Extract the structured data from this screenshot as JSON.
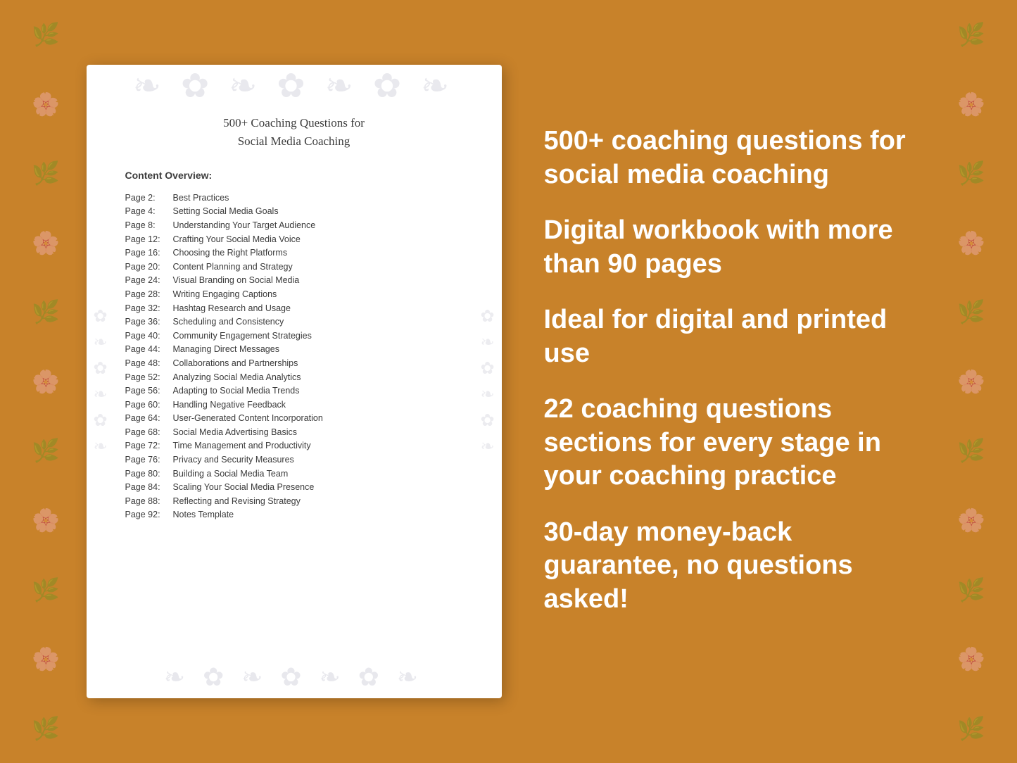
{
  "background": {
    "color": "#C8822A"
  },
  "document": {
    "title_line1": "500+ Coaching Questions for",
    "title_line2": "Social Media Coaching",
    "section_label": "Content Overview:",
    "toc": [
      {
        "page": "Page  2:",
        "title": "Best Practices"
      },
      {
        "page": "Page  4:",
        "title": "Setting Social Media Goals"
      },
      {
        "page": "Page  8:",
        "title": "Understanding Your Target Audience"
      },
      {
        "page": "Page 12:",
        "title": "Crafting Your Social Media Voice"
      },
      {
        "page": "Page 16:",
        "title": "Choosing the Right Platforms"
      },
      {
        "page": "Page 20:",
        "title": "Content Planning and Strategy"
      },
      {
        "page": "Page 24:",
        "title": "Visual Branding on Social Media"
      },
      {
        "page": "Page 28:",
        "title": "Writing Engaging Captions"
      },
      {
        "page": "Page 32:",
        "title": "Hashtag Research and Usage"
      },
      {
        "page": "Page 36:",
        "title": "Scheduling and Consistency"
      },
      {
        "page": "Page 40:",
        "title": "Community Engagement Strategies"
      },
      {
        "page": "Page 44:",
        "title": "Managing Direct Messages"
      },
      {
        "page": "Page 48:",
        "title": "Collaborations and Partnerships"
      },
      {
        "page": "Page 52:",
        "title": "Analyzing Social Media Analytics"
      },
      {
        "page": "Page 56:",
        "title": "Adapting to Social Media Trends"
      },
      {
        "page": "Page 60:",
        "title": "Handling Negative Feedback"
      },
      {
        "page": "Page 64:",
        "title": "User-Generated Content Incorporation"
      },
      {
        "page": "Page 68:",
        "title": "Social Media Advertising Basics"
      },
      {
        "page": "Page 72:",
        "title": "Time Management and Productivity"
      },
      {
        "page": "Page 76:",
        "title": "Privacy and Security Measures"
      },
      {
        "page": "Page 80:",
        "title": "Building a Social Media Team"
      },
      {
        "page": "Page 84:",
        "title": "Scaling Your Social Media Presence"
      },
      {
        "page": "Page 88:",
        "title": "Reflecting and Revising Strategy"
      },
      {
        "page": "Page 92:",
        "title": "Notes Template"
      }
    ]
  },
  "features": [
    {
      "id": "feature-1",
      "text": "500+ coaching questions for social media coaching"
    },
    {
      "id": "feature-2",
      "text": "Digital workbook with more than 90 pages"
    },
    {
      "id": "feature-3",
      "text": "Ideal for digital and printed use"
    },
    {
      "id": "feature-4",
      "text": "22 coaching questions sections for every stage in your coaching practice"
    },
    {
      "id": "feature-5",
      "text": "30-day money-back guarantee, no questions asked!"
    }
  ]
}
